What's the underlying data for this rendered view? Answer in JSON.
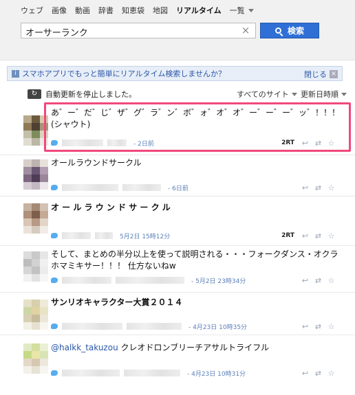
{
  "nav": {
    "items": [
      "ウェブ",
      "画像",
      "動画",
      "辞書",
      "知恵袋",
      "地図",
      "リアルタイム"
    ],
    "active": "リアルタイム",
    "more_label": "一覧"
  },
  "search": {
    "query": "オーサーランク",
    "button_label": "検索"
  },
  "banner": {
    "text": "スマホアプリでもっと簡単にリアルタイム検索しませんか？",
    "close_label": "閉じる"
  },
  "toolbar": {
    "status": "自動更新を停止しました。",
    "site_filter": "すべてのサイト",
    "sort_filter": "更新日時順"
  },
  "tweets": [
    {
      "text": "あ゛ー゛だ゛じ゛ザ゛グ゛ラ゛ン゛ボ゛ォ゛オ゛オ゛ー゛ー゛ー゛ッ゛！！！(シャウト)",
      "time": "- 2日前",
      "rt": "2RT"
    },
    {
      "text": "オールラウンドサークル",
      "time": "- 6日前",
      "rt": ""
    },
    {
      "text": "オ ー ル ラ ウ ン ド サ ー ク ル",
      "time": "5月2日 15時12分",
      "rt": "2RT"
    },
    {
      "text": "そして、まとめの半分以上を使って説明される・・・フォークダンス・オクラホマミキサー！！！ 仕方ないねw",
      "time": "- 5月2日 23時34分",
      "rt": ""
    },
    {
      "text": "サンリオキャラクター大賞２０１４",
      "time": "- 4月23日 10時35分",
      "rt": ""
    },
    {
      "mention": "@halkk_takuzou",
      "text": " クレオドロンブリーチアサルトライフル",
      "time": "- 4月23日 10時31分",
      "rt": ""
    }
  ],
  "colors": {
    "accent": "#2f6fd6",
    "highlight": "#f0487c",
    "link": "#2a56a8"
  }
}
